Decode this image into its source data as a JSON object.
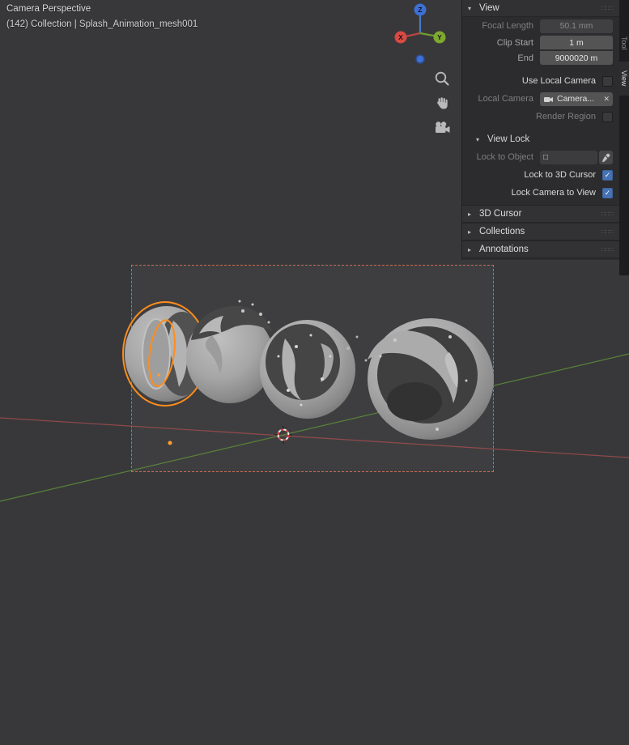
{
  "viewport": {
    "view_label": "Camera Perspective",
    "collection_label": "(142) Collection | Splash_Animation_mesh001"
  },
  "gizmo": {
    "x": "X",
    "y": "Y",
    "z": "Z"
  },
  "tabs": {
    "tool": "Tool",
    "view": "View"
  },
  "panel": {
    "view": {
      "title": "View",
      "focal_length": {
        "label": "Focal Length",
        "value": "50.1 mm"
      },
      "clip_start": {
        "label": "Clip Start",
        "value": "1 m"
      },
      "clip_end": {
        "label": "End",
        "value": "9000020 m"
      },
      "use_local_camera": {
        "label": "Use Local Camera",
        "checked": false
      },
      "local_camera": {
        "label": "Local Camera",
        "value": "Camera..."
      },
      "render_region": {
        "label": "Render Region",
        "checked": false
      }
    },
    "view_lock": {
      "title": "View Lock",
      "lock_to_object": {
        "label": "Lock to Object",
        "value": ""
      },
      "lock_to_3d_cursor": {
        "label": "Lock to 3D Cursor",
        "checked": true
      },
      "lock_camera_to_view": {
        "label": "Lock Camera to View",
        "checked": true
      }
    },
    "collapsed": [
      {
        "title": "3D Cursor"
      },
      {
        "title": "Collections"
      },
      {
        "title": "Annotations"
      }
    ]
  },
  "icons": {
    "open_triangle": "▾",
    "closed_triangle": "▸",
    "check": "✓",
    "clear": "✕",
    "grip": "∷∷∷",
    "object_box": "□"
  },
  "colors": {
    "selection_orange": "#ff8d1a",
    "checkbox_blue": "#4772b3",
    "axis_x_red": "#a14d4d",
    "axis_y_green": "#5c8a39",
    "camera_border": "#c96a52"
  }
}
